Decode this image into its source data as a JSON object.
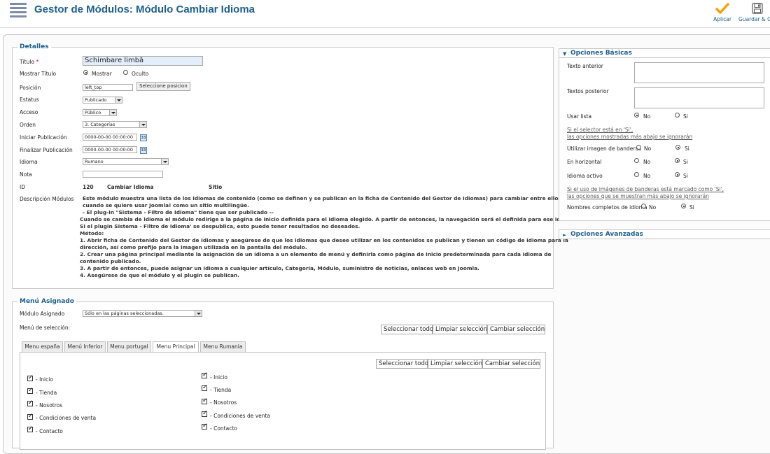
{
  "header": {
    "title": "Gestor de Módulos: Módulo Cambiar Idioma",
    "apply_label": "Aplicar",
    "save_close_label": "Guardar & Ce"
  },
  "details": {
    "legend": "Detalles",
    "title_label": "Título",
    "title_value": "Schimbare limbă",
    "show_title_label": "Mostrar Título",
    "show_option": "Mostrar",
    "hide_option": "Oculto",
    "position_label": "Posición",
    "position_value": "left_top",
    "position_button": "Seleccione posicion",
    "status_label": "Estatus",
    "status_value": "Publicado",
    "access_label": "Acceso",
    "access_value": "Público",
    "order_label": "Orden",
    "order_value": "3. Categorías",
    "start_label": "Iniciar Publicación",
    "start_value": "0000-00-00 00:00:00",
    "end_label": "Finalizar Publicación",
    "end_value": "0000-00-00 00:00:00",
    "language_label": "Idioma",
    "language_value": "Rumano",
    "note_label": "Nota",
    "id_label": "ID",
    "id_value": "120",
    "module_name": "Cambiar Idioma",
    "module_site": "Sitio",
    "desc_label": "Descripción Módulos",
    "description_lines": [
      "Este módulo muestra una lista de los idiomas de contenido (como se definen y se publican en la ficha de Contenido del Gestor de Idiomas) para cambiar entre ellos",
      "cuando se quiere usar Joomla! como un sitio multilingüe.",
      "- El plug-in \"Sistema - Filtro de Idioma\" tiene que ser publicado --",
      "Cuando se cambia de idioma el módulo redirige a la página de inicio definida para el idioma elegido. A partir de entonces, la navegación será el definida para ese idioma.",
      "Si el plugin Sistema - Filtro de Idioma' se despublica, esto puede tener resultados no deseados.",
      "Método:",
      "1. Abrir ficha de Contenido del Gestor de Idiomas y asegúrese de que los idiomas que desee utilizar en los contenidos se publican y tienen un código de idioma para la",
      "dirección, así como prefijo para la imagen utilizada en la pantalla del módulo.",
      "2. Crear una página principal mediante la asignación de un idioma a un elemento de menú y definirla como página de inicio predeterminada para cada idioma de",
      "contenido publicado.",
      "3. A partir de entonces, puede asignar un idioma a cualquier artículo, Categoría, Módulo, suministro de noticias, enlaces web en Joomla.",
      "4. Asegúrese de que el módulo y el plugin se publican."
    ]
  },
  "menu": {
    "legend": "Menú Asignado",
    "assigned_label": "Módulo Asignado",
    "assigned_value": "Sólo en las páginas seleccionadas.",
    "selection_label": "Menú de selección:",
    "select_all": "Seleccionar todo",
    "clear_selection": "Limpiar selección",
    "toggle_selection": "Cambiar selección",
    "tabs": [
      "Menu españa",
      "Menú Inferior",
      "Menu portugal",
      "Menu Principal",
      "Menu Rumania"
    ],
    "items_left": [
      "- Inicio",
      "- Tienda",
      "- Nosotros",
      "- Condiciones de venta",
      "- Contacto"
    ],
    "items_right": [
      "- Inicio",
      "- Tienda",
      "- Nosotros",
      "- Condiciones de venta",
      "- Contacto"
    ]
  },
  "basic_options": {
    "title": "Opciones Básicas",
    "pre_text_label": "Texto anterior",
    "post_text_label": "Textos posterior",
    "use_list_label": "Usar lista",
    "no": "No",
    "yes": "Si",
    "note1_line1": "Si el selector está en 'Si',",
    "note1_line2": "las opciones mostradas más abajo se ignorarán",
    "flags_label": "Utilizar imagen de banderas",
    "horizontal_label": "En horizontal",
    "active_label": "Idioma activo",
    "note2_line1": "Si el uso de imágenes de banderas está marcado como 'Si',",
    "note2_line2": "las opciones que se muestran más abajo se ignorarán",
    "full_names_label": "Nombres completos de idioma"
  },
  "advanced_options": {
    "title": "Opciones Avanzadas"
  },
  "colors": {
    "accent": "#1d5e8c",
    "apply_check": "#f0a30a"
  }
}
